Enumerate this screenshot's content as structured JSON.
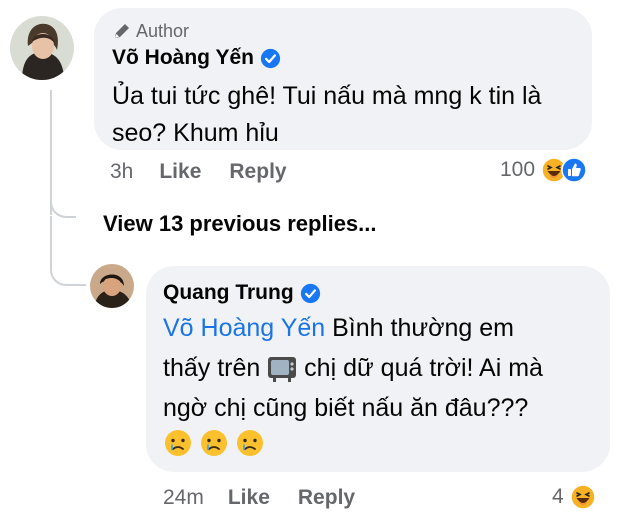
{
  "comment": {
    "badge": "Author",
    "author_name": "Võ Hoàng Yến",
    "text_line1": "Ủa tui tức ghê! Tui nấu mà mng k tin là",
    "text_line2": "seo? Khum hỉu",
    "time": "3h",
    "like_label": "Like",
    "reply_label": "Reply",
    "reaction_count": "100",
    "reaction_icons": [
      "haha-reaction-icon",
      "like-reaction-icon"
    ]
  },
  "view_previous": "View 13 previous replies...",
  "reply": {
    "author_name": "Quang Trung",
    "mention": "Võ Hoàng Yến",
    "text_line1_rest": " Bình thường em",
    "text_line2_a": "thấy trên ",
    "text_line2_b": " chị dữ quá trời! Ai mà",
    "text_line3": "ngờ chị cũng biết nấu ăn đâu???",
    "emoji_row": [
      "crying-face-icon",
      "crying-face-icon",
      "crying-face-icon"
    ],
    "time": "24m",
    "like_label": "Like",
    "reply_label": "Reply",
    "reaction_count": "4",
    "reaction_icons": [
      "haha-reaction-icon"
    ]
  },
  "colors": {
    "bubble": "#f0f2f5",
    "meta_text": "#65676b",
    "mention": "#1b74e4",
    "verified": "#1877f2"
  }
}
